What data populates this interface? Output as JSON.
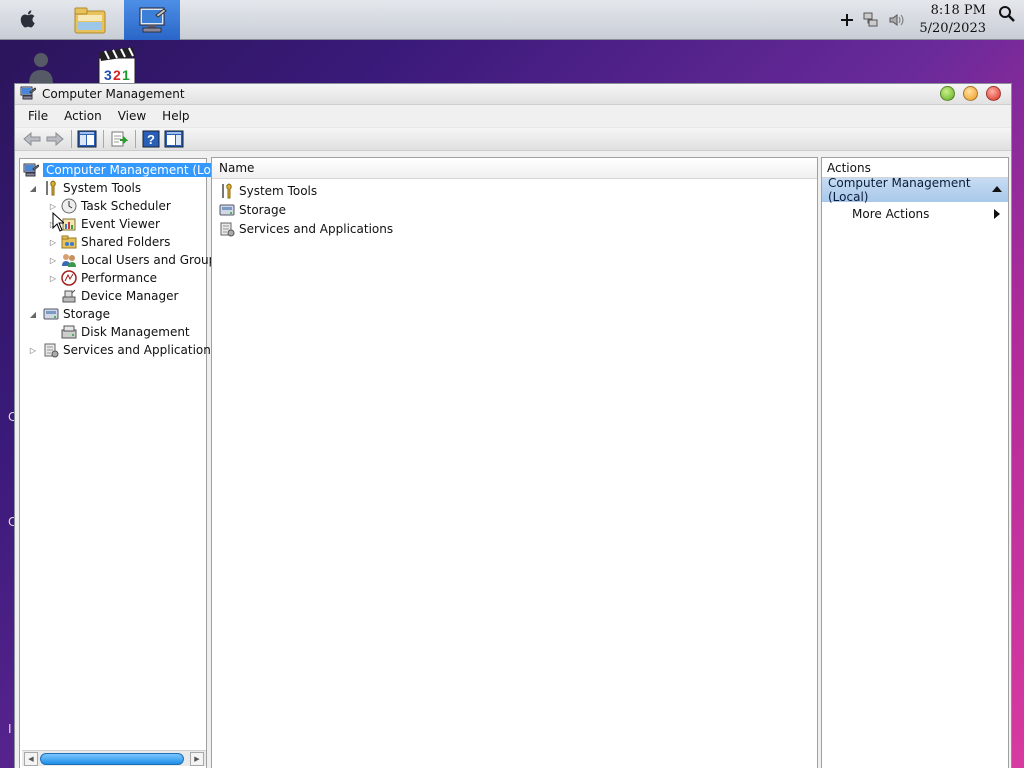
{
  "topbar": {
    "clock_time": "8:18 PM",
    "clock_date": "5/20/2023",
    "icons": [
      "apple-icon",
      "file-explorer-icon",
      "computer-management-icon",
      "add-icon",
      "network-icon",
      "volume-icon",
      "search-icon"
    ]
  },
  "window": {
    "title": "Computer Management"
  },
  "menu": {
    "file": "File",
    "action": "Action",
    "view": "View",
    "help": "Help"
  },
  "tree": {
    "root": "Computer Management (Local",
    "system_tools": "System Tools",
    "task_scheduler": "Task Scheduler",
    "event_viewer": "Event Viewer",
    "shared_folders": "Shared Folders",
    "local_users": "Local Users and Groups",
    "performance": "Performance",
    "device_manager": "Device Manager",
    "storage": "Storage",
    "disk_management": "Disk Management",
    "services": "Services and Applications"
  },
  "main": {
    "column_name": "Name",
    "items": [
      "System Tools",
      "Storage",
      "Services and Applications"
    ]
  },
  "actions": {
    "header": "Actions",
    "section": "Computer Management (Local)",
    "more_actions": "More Actions"
  },
  "colors": {
    "selection": "#3399ff",
    "actions_section": "#b5d0ee"
  }
}
